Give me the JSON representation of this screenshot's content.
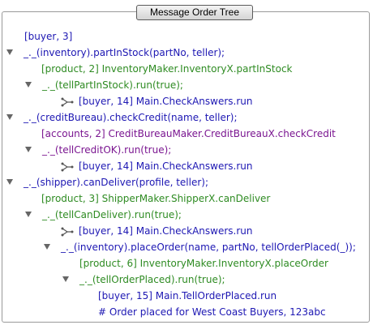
{
  "title_button": "Message Order Tree",
  "tree": {
    "r0": "[buyer, 3]",
    "r1": "_._(inventory).partInStock(partNo, teller);",
    "r2": "[product, 2] InventoryMaker.InventoryX.partInStock",
    "r3": "_._(tellPartInStock).run(true);",
    "r4": "[buyer, 14] Main.CheckAnswers.run",
    "r5": "_._(creditBureau).checkCredit(name, teller);",
    "r6": "[accounts, 2] CreditBureauMaker.CreditBureauX.checkCredit",
    "r7": "_._(tellCreditOK).run(true);",
    "r8": "[buyer, 14] Main.CheckAnswers.run",
    "r9": "_._(shipper).canDeliver(profile, teller);",
    "r10": "[product, 3] ShipperMaker.ShipperX.canDeliver",
    "r11": "_._(tellCanDeliver).run(true);",
    "r12": "[buyer, 14] Main.CheckAnswers.run",
    "r13": "_._(inventory).placeOrder(name, partNo, tellOrderPlaced(_));",
    "r14": "[product, 6] InventoryMaker.InventoryX.placeOrder",
    "r15": "_._(tellOrderPlaced).run(true);",
    "r16": "[buyer, 15] Main.TellOrderPlaced.run",
    "r17": "# Order placed for West Coast Buyers, 123abc"
  },
  "icons": {
    "expanded": "disclosure-triangle-expanded",
    "branch": "message-branch"
  },
  "colors": {
    "blue": "#1d17b3",
    "green": "#2e8b22",
    "purple": "#7a1590",
    "disclosure": "#666666"
  }
}
